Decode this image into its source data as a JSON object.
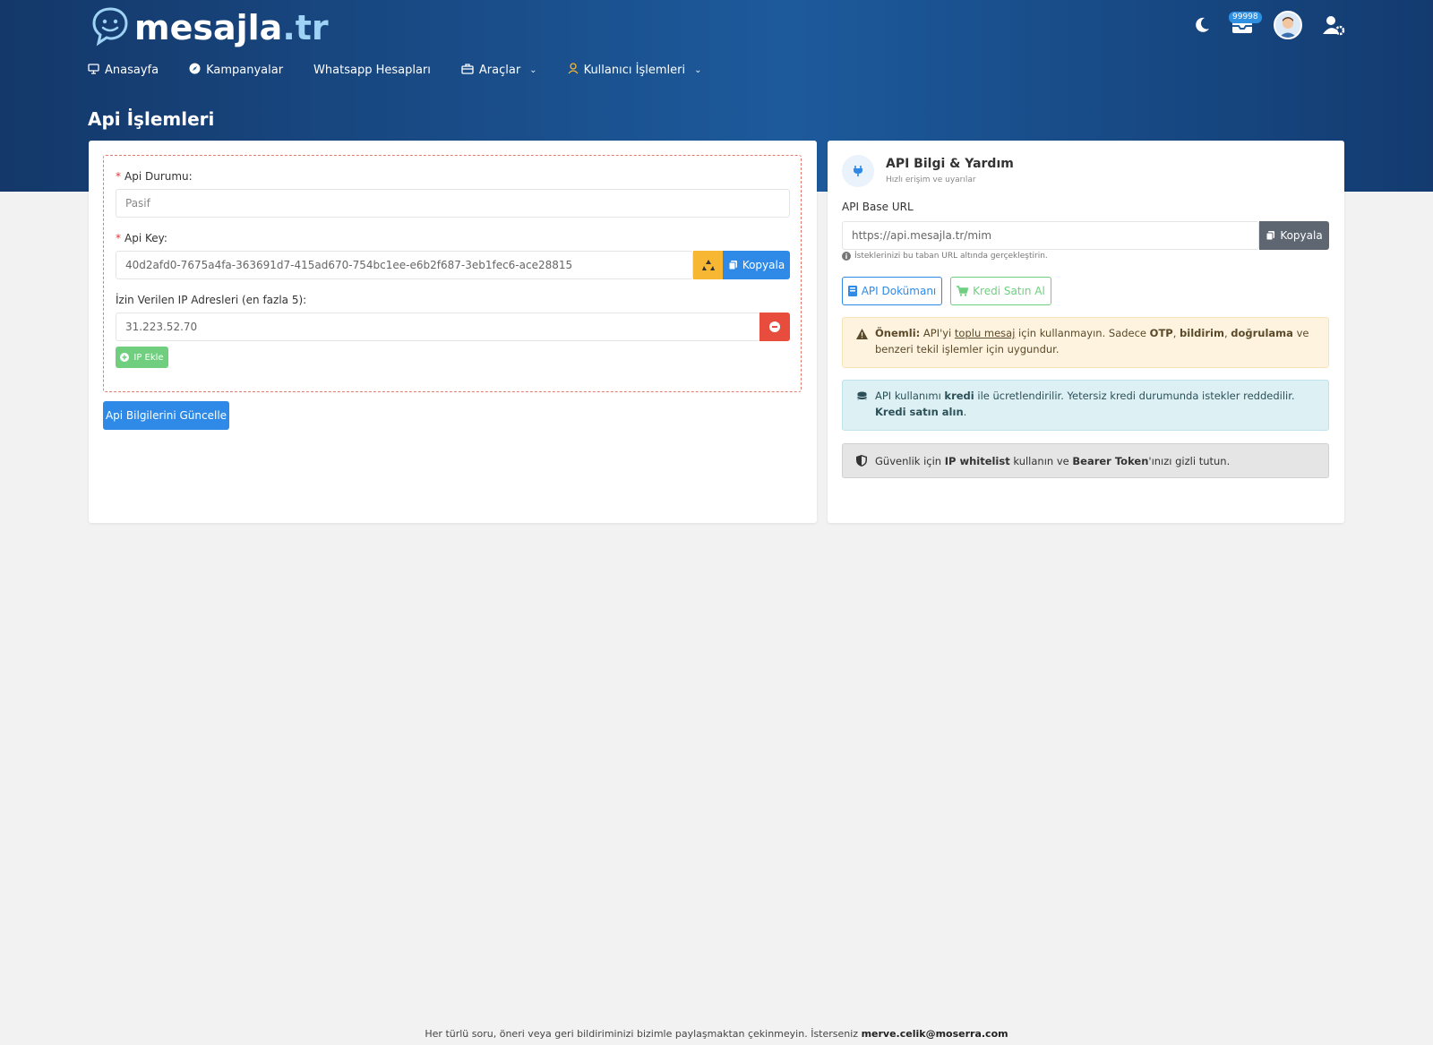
{
  "brand": {
    "logo_main": "mesajla",
    "logo_tld": ".tr"
  },
  "header": {
    "notification_count": "99998",
    "nav": [
      {
        "label": "Anasayfa",
        "icon": "monitor-icon"
      },
      {
        "label": "Kampanyalar",
        "icon": "compass-icon"
      },
      {
        "label": "Whatsapp Hesapları"
      },
      {
        "label": "Araçlar",
        "icon": "briefcase-icon",
        "dropdown": true
      },
      {
        "label": "Kullanıcı İşlemleri",
        "icon": "user-icon",
        "dropdown": true
      }
    ]
  },
  "page": {
    "title": "Api İşlemleri"
  },
  "form": {
    "status_label": "Api Durumu:",
    "status_value": "Pasif",
    "key_label": "Api Key:",
    "key_value": "40d2afd0-7675a4fa-363691d7-415ad670-754bc1ee-e6b2f687-3eb1fec6-ace28815",
    "copy_label": "Kopyala",
    "ip_label": "İzin Verilen IP Adresleri (en fazla 5):",
    "ip_value": "31.223.52.70",
    "add_ip_label": "IP Ekle",
    "update_label": "Api Bilgilerini Güncelle"
  },
  "help": {
    "title": "API Bilgi & Yardım",
    "subtitle": "Hızlı erişim ve uyarılar",
    "base_url_label": "API Base URL",
    "base_url_value": "https://api.mesajla.tr/mim",
    "copy_label": "Kopyala",
    "hint": "İsteklerinizi bu taban URL altında gerçekleştirin.",
    "doc_button": "API Dokümanı",
    "buy_button": "Kredi Satın Al",
    "warn": {
      "strong": "Önemli:",
      "t1": " API'yi ",
      "link": "toplu mesaj",
      "t2": " için kullanmayın. Sadece ",
      "b1": "OTP",
      "sep1": ", ",
      "b2": "bildirim",
      "sep2": ", ",
      "b3": "doğrulama",
      "t3": " ve benzeri tekil işlemler için uygundur."
    },
    "info": {
      "t1": "API kullanımı ",
      "b1": "kredi",
      "t2": " ile ücretlendirilir. Yetersiz kredi durumunda istekler reddedilir. ",
      "b2": "Kredi satın alın",
      "t3": "."
    },
    "security": {
      "t1": "Güvenlik için ",
      "b1": "IP whitelist",
      "t2": " kullanın ve ",
      "b2": "Bearer Token",
      "t3": "'ınızı gizli tutun."
    }
  },
  "footer": {
    "text": "Her türlü soru, öneri veya geri bildiriminizi bizimle paylaşmaktan çekinmeyin. İsterseniz ",
    "email": "merve.celik@moserra.com"
  },
  "colors": {
    "primary": "#2e8ae6",
    "header_dark": "#14386a",
    "warning": "#f7b733",
    "danger": "#e74c3c",
    "success": "#6fcf7f"
  }
}
